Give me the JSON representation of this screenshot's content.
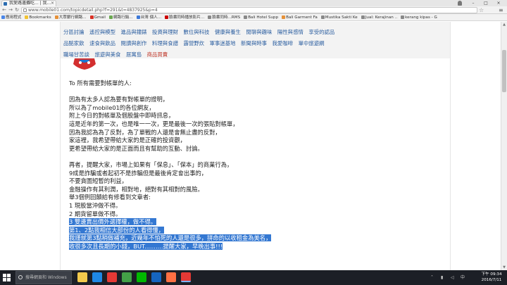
{
  "browser": {
    "tab_title": "我愛路邊攤吃... | 我...",
    "url": "www.mobile01.com/topicdetail.php?f=291&t=4837925&p=4",
    "bookmarks": [
      {
        "label": "應用程式",
        "color": "#4a86e8"
      },
      {
        "label": "Bookmarks",
        "color": "#f1c232"
      },
      {
        "label": "大眾銀行網路...",
        "color": "#e69138"
      },
      {
        "label": "Gmail",
        "color": "#d93025"
      },
      {
        "label": "網路行銷...",
        "color": "#6aa84f"
      },
      {
        "label": "台灣 個人...",
        "color": "#3c78d8"
      },
      {
        "label": "臉書同時播放影片...",
        "color": "#cc0000"
      },
      {
        "label": "臉書同時...RMS",
        "color": "#888888"
      },
      {
        "label": "Bali Hotel Supp",
        "color": "#888888"
      },
      {
        "label": "Bali Garment Fa",
        "color": "#e69138"
      },
      {
        "label": "Mustika Sakti Ke",
        "color": "#888888"
      },
      {
        "label": "Jual: Kerajinan ..",
        "color": "#888888"
      },
      {
        "label": "kerang kipas - G",
        "color": "#888888"
      }
    ]
  },
  "forum_nav": {
    "rows": [
      [
        {
          "label": "分區討論",
          "highlight": false
        },
        {
          "label": "遙控與模型",
          "highlight": false
        },
        {
          "label": "進品與鐘錶",
          "highlight": false
        },
        {
          "label": "投資與理財",
          "highlight": false
        },
        {
          "label": "數位與科技",
          "highlight": false
        },
        {
          "label": "健康與養生",
          "highlight": false
        },
        {
          "label": "閒聊與趣味",
          "highlight": false
        },
        {
          "label": "陽性與感情",
          "highlight": false
        },
        {
          "label": "享受的認品",
          "highlight": false
        }
      ],
      [
        {
          "label": "品酩家飲",
          "highlight": false
        },
        {
          "label": "速食與飲品",
          "highlight": false
        },
        {
          "label": "閱讀與創作",
          "highlight": false
        },
        {
          "label": "料理與食譜",
          "highlight": false
        },
        {
          "label": "露營野炊",
          "highlight": false
        },
        {
          "label": "軍事迷基地",
          "highlight": false
        },
        {
          "label": "新聞與時事",
          "highlight": false
        },
        {
          "label": "我愛咖啡",
          "highlight": false
        },
        {
          "label": "單中旅遊網",
          "highlight": false
        }
      ],
      [
        {
          "label": "職場甘苦談",
          "highlight": false
        },
        {
          "label": "旅遊與美食",
          "highlight": false
        },
        {
          "label": "居寓島",
          "highlight": false
        },
        {
          "label": "商品買賣",
          "highlight": true
        }
      ]
    ]
  },
  "post": {
    "lines": [
      {
        "text": "To 所有需要對帳單的人:",
        "selected": false
      },
      {
        "text": "",
        "selected": false
      },
      {
        "text": "因為有太多人認為要有對帳單的證明，",
        "selected": false
      },
      {
        "text": "所以為了mobile01的各位網友，",
        "selected": false
      },
      {
        "text": "附上今日的對帳單及個股盤中即時訊息，",
        "selected": false
      },
      {
        "text": "這是近年的第一次，也是唯一一次，更是最後一次的張貼對帳單，",
        "selected": false
      },
      {
        "text": "因為我認為為了反對，為了單戰的人還是會無止盡的反對，",
        "selected": false
      },
      {
        "text": "家這裡，我希望帶給大家的是正確的投資觀，",
        "selected": false
      },
      {
        "text": "更希望帶給大家的是正面而且有幫助的互動、討論。",
        "selected": false
      },
      {
        "text": "",
        "selected": false
      },
      {
        "text": "再者，提醒大家，市場上如果有「保息」、「保本」的商業行為，",
        "selected": false
      },
      {
        "text": "9成是詐騙或者起初不是詐騙但是最後肯定會出事的，",
        "selected": false
      },
      {
        "text": "不要貪圖短暫的利益，",
        "selected": false
      },
      {
        "text": "金融操作有其利潤，相對地，絕對有其相對的風險。",
        "selected": false
      },
      {
        "text": "舉3個例回饋給有修看到文章者:",
        "selected": false
      },
      {
        "text": "1 現股當沖做不得。",
        "selected": false
      },
      {
        "text": "2 期貨留單做不得。",
        "selected": false
      },
      {
        "text": "3 雙邊賣出價外選擇權，做不得。",
        "selected": true
      },
      {
        "text": "第1、2點我相信大部份的人看得懂，",
        "selected": true
      },
      {
        "text": "我謹就第3點稍做補充，近幾年不怕死的人還是很多，拼命的以收租金為美名，",
        "selected": true
      },
      {
        "text": "收很多次且長期的小錢，BUT..........提醒大家，早晚出事!!!",
        "selected": true
      }
    ]
  },
  "taskbar": {
    "search_placeholder": "搜尋網頁和 Windows",
    "apps": [
      {
        "icon": "folder-icon",
        "color": "#f2c94c",
        "active": false
      },
      {
        "icon": "store-icon",
        "color": "#1e88e5",
        "active": false
      },
      {
        "icon": "chrome-icon",
        "color": "#e53935",
        "active": false
      },
      {
        "icon": "calculator-icon",
        "color": "#43a047",
        "active": false
      },
      {
        "icon": "line-icon",
        "color": "#00b900",
        "active": false
      },
      {
        "icon": "edge-icon",
        "color": "#1565c0",
        "active": false
      },
      {
        "icon": "firefox-icon",
        "color": "#ff7043",
        "active": false
      },
      {
        "icon": "chrome-active-icon",
        "color": "#e53935",
        "active": true
      }
    ],
    "clock_time": "下午 09:34",
    "clock_date": "2016/7/11"
  }
}
